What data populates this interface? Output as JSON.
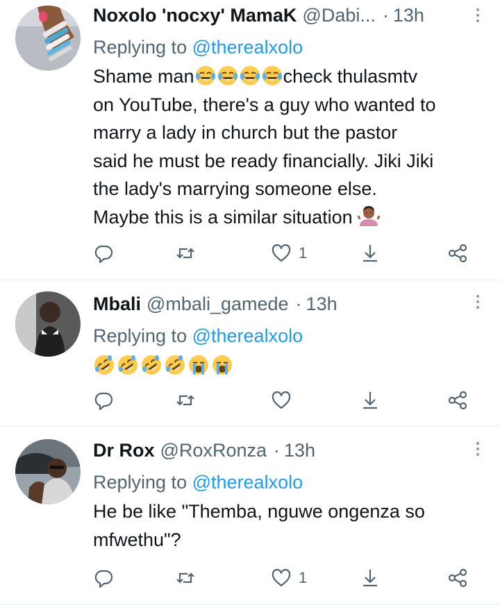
{
  "replies": [
    {
      "name": "Noxolo 'nocxy' MamaK",
      "handle": "@Dabi...",
      "separator": "·",
      "time": "13h",
      "replying_prefix": "Replying to",
      "replying_to": "@therealxolo",
      "text_line1_before": "Shame man",
      "text_line1_after": "check thulasmtv",
      "text_rest": "on YouTube, there's a guy who wanted to\nmarry a lady in church but the pastor\nsaid he must be ready financially. Jiki Jiki\nthe lady's marrying someone else.\nMaybe this is a similar situation",
      "emojis_inline": [
        "face-with-tears-of-joy",
        "face-with-tears-of-joy",
        "face-with-tears-of-joy",
        "face-with-tears-of-joy"
      ],
      "emoji_end": "person-shrugging",
      "likes": "1"
    },
    {
      "name": "Mbali",
      "handle": "@mbali_gamede",
      "separator": "·",
      "time": "13h",
      "replying_prefix": "Replying to",
      "replying_to": "@therealxolo",
      "emojis": [
        "rolling-on-floor-laughing",
        "rolling-on-floor-laughing",
        "rolling-on-floor-laughing",
        "rolling-on-floor-laughing",
        "loudly-crying-face",
        "loudly-crying-face"
      ],
      "likes": ""
    },
    {
      "name": "Dr Rox",
      "handle": "@RoxRonza",
      "separator": "·",
      "time": "13h",
      "replying_prefix": "Replying to",
      "replying_to": "@therealxolo",
      "text": "He be like \"Themba, nguwe ongenza so\nmfwethu\"?",
      "likes": "1"
    }
  ],
  "colors": {
    "text_primary": "#0f1419",
    "text_secondary": "#536471",
    "mention": "#1d9bf0",
    "divider": "#e6ecf0"
  },
  "icons": {
    "reply": "reply-icon",
    "retweet": "retweet-icon",
    "like": "like-icon",
    "download": "download-icon",
    "share": "share-icon",
    "more": "more-icon"
  }
}
